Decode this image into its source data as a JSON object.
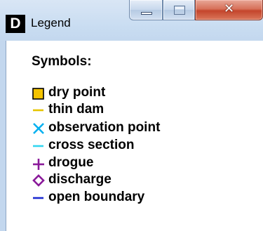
{
  "window": {
    "title": "Legend",
    "app_icon_letter": "D",
    "caption_buttons": {
      "minimize": "minimize",
      "maximize": "maximize",
      "close": "close"
    }
  },
  "legend": {
    "heading": "Symbols:",
    "items": [
      {
        "label": "dry point",
        "symbol": "filled-square",
        "color": "#f5c400",
        "stroke": "#000000"
      },
      {
        "label": "thin dam",
        "symbol": "dash",
        "color": "#e6c400"
      },
      {
        "label": "observation point",
        "symbol": "cross-x",
        "color": "#00b0f0"
      },
      {
        "label": "cross section",
        "symbol": "dash",
        "color": "#33d6f0"
      },
      {
        "label": "drogue",
        "symbol": "plus",
        "color": "#8a1a9a"
      },
      {
        "label": "discharge",
        "symbol": "diamond",
        "color": "#8a1a9a"
      },
      {
        "label": "open boundary",
        "symbol": "dash",
        "color": "#1c2ad0"
      }
    ]
  }
}
